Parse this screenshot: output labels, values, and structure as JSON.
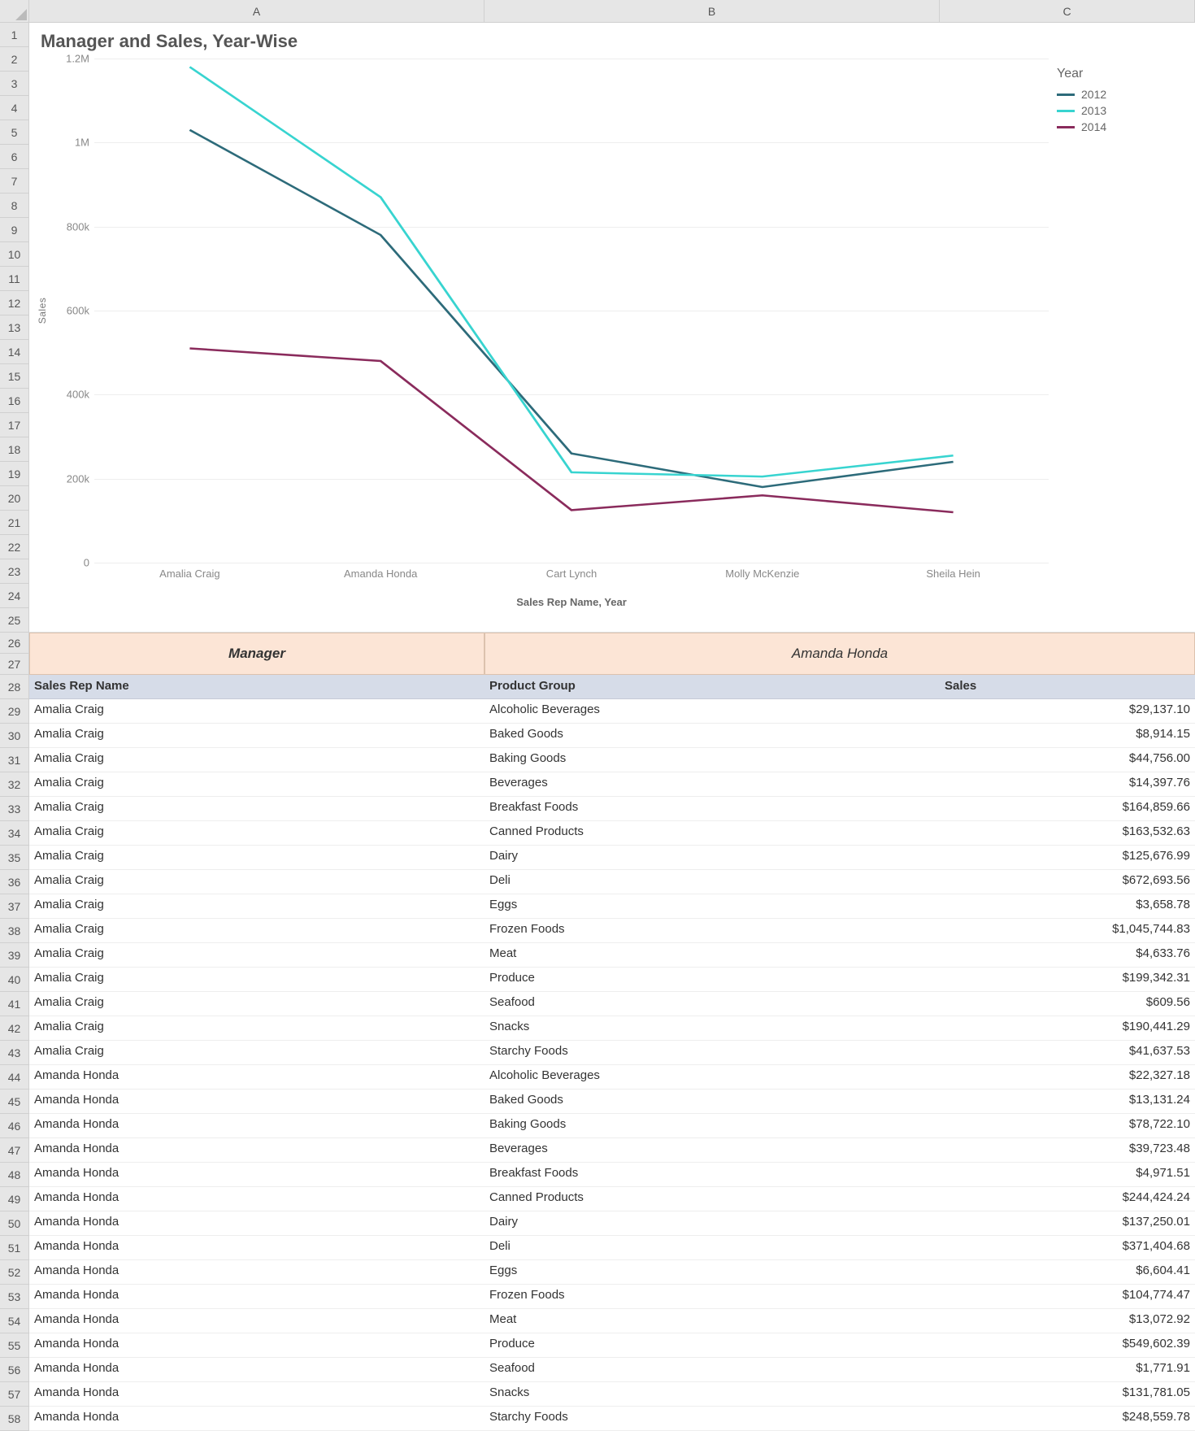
{
  "columns": [
    "A",
    "B",
    "C"
  ],
  "chart": {
    "title": "Manager and Sales, Year-Wise",
    "ylabel": "Sales",
    "xlabel": "Sales Rep Name, Year",
    "legend_title": "Year"
  },
  "chart_data": {
    "type": "line",
    "categories": [
      "Amalia Craig",
      "Amanda Honda",
      "Cart Lynch",
      "Molly McKenzie",
      "Sheila Hein"
    ],
    "series": [
      {
        "name": "2012",
        "color": "#2d6b7a",
        "values": [
          1030000,
          780000,
          260000,
          180000,
          240000
        ]
      },
      {
        "name": "2013",
        "color": "#38d4d0",
        "values": [
          1180000,
          870000,
          215000,
          205000,
          255000
        ]
      },
      {
        "name": "2014",
        "color": "#8a2b5c",
        "values": [
          510000,
          480000,
          125000,
          160000,
          120000
        ]
      }
    ],
    "ylim": [
      0,
      1200000
    ],
    "yticks": [
      0,
      200000,
      400000,
      600000,
      800000,
      1000000,
      1200000
    ],
    "ytick_labels": [
      "0",
      "200k",
      "400k",
      "600k",
      "800k",
      "1M",
      "1.2M"
    ]
  },
  "section": {
    "left": "Manager",
    "right": "Amanda Honda"
  },
  "table": {
    "headers": [
      "Sales Rep Name",
      "Product Group",
      "Sales"
    ],
    "rows": [
      [
        "Amalia Craig",
        "Alcoholic Beverages",
        "$29,137.10"
      ],
      [
        "Amalia Craig",
        "Baked Goods",
        "$8,914.15"
      ],
      [
        "Amalia Craig",
        "Baking Goods",
        "$44,756.00"
      ],
      [
        "Amalia Craig",
        "Beverages",
        "$14,397.76"
      ],
      [
        "Amalia Craig",
        "Breakfast Foods",
        "$164,859.66"
      ],
      [
        "Amalia Craig",
        "Canned Products",
        "$163,532.63"
      ],
      [
        "Amalia Craig",
        "Dairy",
        "$125,676.99"
      ],
      [
        "Amalia Craig",
        "Deli",
        "$672,693.56"
      ],
      [
        "Amalia Craig",
        "Eggs",
        "$3,658.78"
      ],
      [
        "Amalia Craig",
        "Frozen Foods",
        "$1,045,744.83"
      ],
      [
        "Amalia Craig",
        "Meat",
        "$4,633.76"
      ],
      [
        "Amalia Craig",
        "Produce",
        "$199,342.31"
      ],
      [
        "Amalia Craig",
        "Seafood",
        "$609.56"
      ],
      [
        "Amalia Craig",
        "Snacks",
        "$190,441.29"
      ],
      [
        "Amalia Craig",
        "Starchy Foods",
        "$41,637.53"
      ],
      [
        "Amanda Honda",
        "Alcoholic Beverages",
        "$22,327.18"
      ],
      [
        "Amanda Honda",
        "Baked Goods",
        "$13,131.24"
      ],
      [
        "Amanda Honda",
        "Baking Goods",
        "$78,722.10"
      ],
      [
        "Amanda Honda",
        "Beverages",
        "$39,723.48"
      ],
      [
        "Amanda Honda",
        "Breakfast Foods",
        "$4,971.51"
      ],
      [
        "Amanda Honda",
        "Canned Products",
        "$244,424.24"
      ],
      [
        "Amanda Honda",
        "Dairy",
        "$137,250.01"
      ],
      [
        "Amanda Honda",
        "Deli",
        "$371,404.68"
      ],
      [
        "Amanda Honda",
        "Eggs",
        "$6,604.41"
      ],
      [
        "Amanda Honda",
        "Frozen Foods",
        "$104,774.47"
      ],
      [
        "Amanda Honda",
        "Meat",
        "$13,072.92"
      ],
      [
        "Amanda Honda",
        "Produce",
        "$549,602.39"
      ],
      [
        "Amanda Honda",
        "Seafood",
        "$1,771.91"
      ],
      [
        "Amanda Honda",
        "Snacks",
        "$131,781.05"
      ],
      [
        "Amanda Honda",
        "Starchy Foods",
        "$248,559.78"
      ]
    ]
  }
}
